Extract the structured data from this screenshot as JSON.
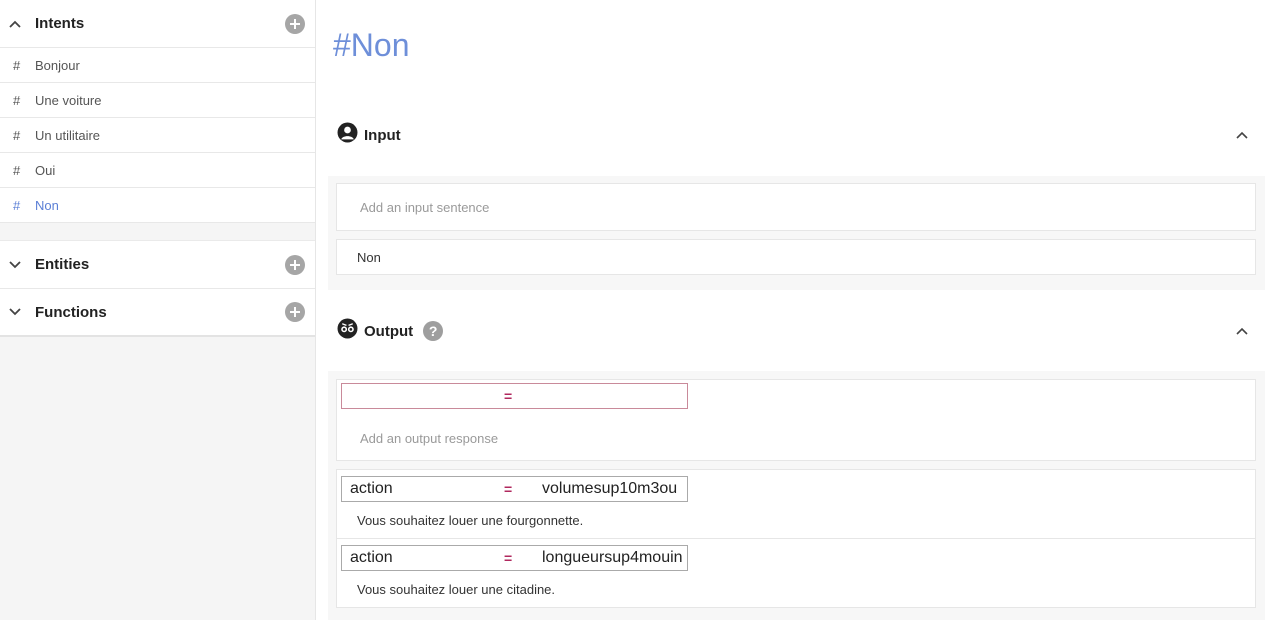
{
  "sidebar": {
    "intents": {
      "title": "Intents",
      "items": [
        {
          "hash": "#",
          "label": "Bonjour"
        },
        {
          "hash": "#",
          "label": "Une voiture"
        },
        {
          "hash": "#",
          "label": "Un utilitaire"
        },
        {
          "hash": "#",
          "label": "Oui"
        },
        {
          "hash": "#",
          "label": "Non"
        }
      ]
    },
    "entities": {
      "title": "Entities"
    },
    "functions": {
      "title": "Functions"
    }
  },
  "main": {
    "title": "#Non",
    "input": {
      "label": "Input",
      "placeholder": "Add an input sentence",
      "sentences": [
        "Non"
      ]
    },
    "output": {
      "label": "Output",
      "help": "?",
      "new_card": {
        "key": "",
        "eq": "=",
        "value": "",
        "placeholder": "Add an output response"
      },
      "responses": [
        {
          "key": "action",
          "eq": "=",
          "value": "volumesup10m3ou",
          "text": "Vous souhaitez louer une fourgonnette."
        },
        {
          "key": "action",
          "eq": "=",
          "value": "longueursup4mouin",
          "text": "Vous souhaitez louer une citadine."
        }
      ]
    }
  },
  "colors": {
    "accent": "#6e8fd9",
    "active_item": "#5b7fd6",
    "equals": "#b0285e",
    "add_icon": "#a6a6a6"
  }
}
